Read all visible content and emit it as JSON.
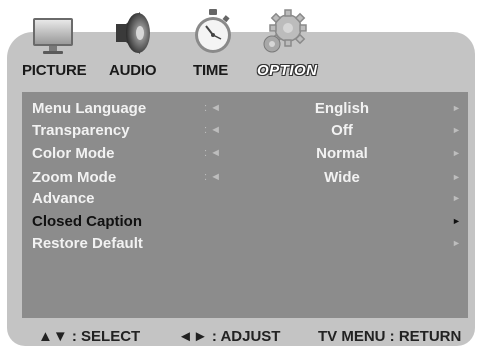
{
  "tabs": [
    {
      "label": "PICTURE",
      "icon": "monitor-icon"
    },
    {
      "label": "AUDIO",
      "icon": "speaker-icon"
    },
    {
      "label": "TIME",
      "icon": "stopwatch-icon"
    },
    {
      "label": "OPTION",
      "icon": "gear-icon",
      "active": true
    }
  ],
  "menu": [
    {
      "label": "Menu Language",
      "left": ": ◄",
      "value": "English",
      "right": "►"
    },
    {
      "label": "Transparency",
      "left": ": ◄",
      "value": "Off",
      "right": "►"
    },
    {
      "label": "Color Mode",
      "left": ": ◄",
      "value": "Normal",
      "right": "►"
    },
    {
      "label": "Zoom Mode",
      "left": ": ◄",
      "value": "Wide",
      "right": "►"
    },
    {
      "label": "Advance",
      "right": "►"
    },
    {
      "label": "Closed Caption",
      "right": "►",
      "selected": true
    },
    {
      "label": "Restore Default",
      "right": "►"
    }
  ],
  "footer": {
    "select": "▲▼ : SELECT",
    "adjust": "◄► : ADJUST",
    "return": "TV MENU : RETURN"
  },
  "colors": {
    "frame": "#c4c4c4",
    "panel": "#8c8c8c",
    "text_light": "#f2f2f2",
    "text_dark": "#1a1a1a"
  }
}
